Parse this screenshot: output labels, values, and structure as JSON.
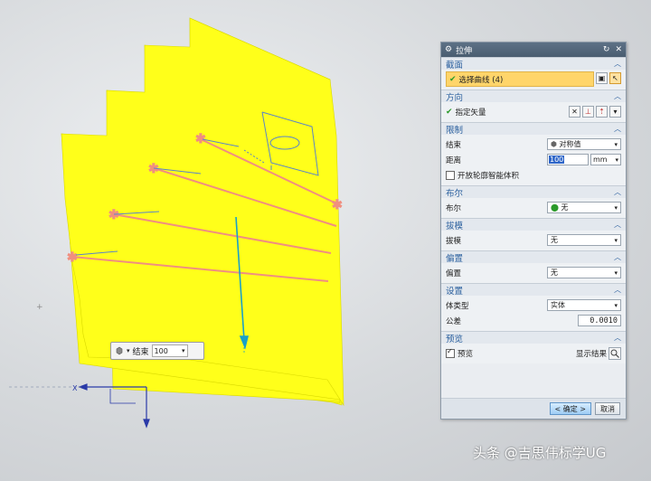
{
  "dialog": {
    "title": "拉伸",
    "sections": {
      "section": {
        "header": "截面",
        "select_curve_label": "选择曲线 (4)"
      },
      "direction": {
        "header": "方向",
        "specify_vector_label": "指定矢量"
      },
      "limits": {
        "header": "限制",
        "end_label": "结束",
        "end_value": "对称值",
        "distance_label": "距离",
        "distance_value": "100",
        "distance_unit": "mm",
        "open_profile_label": "开放轮廓智能体积",
        "open_profile_checked": false
      },
      "boolean": {
        "header": "布尔",
        "boolean_label": "布尔",
        "boolean_value": "无"
      },
      "draft": {
        "header": "拔模",
        "draft_label": "拔模",
        "draft_value": "无"
      },
      "offset": {
        "header": "偏置",
        "offset_label": "偏置",
        "offset_value": "无"
      },
      "settings": {
        "header": "设置",
        "body_type_label": "体类型",
        "body_type_value": "实体",
        "tolerance_label": "公差",
        "tolerance_value": "0.0010"
      },
      "preview": {
        "header": "预览",
        "preview_label": "预览",
        "preview_checked": true,
        "show_result_label": "显示结果"
      }
    },
    "ok_label": "< 确定 >",
    "cancel_label": "取消"
  },
  "viewport": {
    "mini_toolbar": {
      "end_label": "结束",
      "end_value": "100"
    },
    "axis_label": "X"
  },
  "watermark": "头条 @吉思伟标学UG",
  "colors": {
    "surface": "#ffff1a",
    "curve": "#f08f80",
    "vector": "#1aa0c8",
    "section_header": "#2a5f9e",
    "selection_highlight": "#ffd56a"
  }
}
